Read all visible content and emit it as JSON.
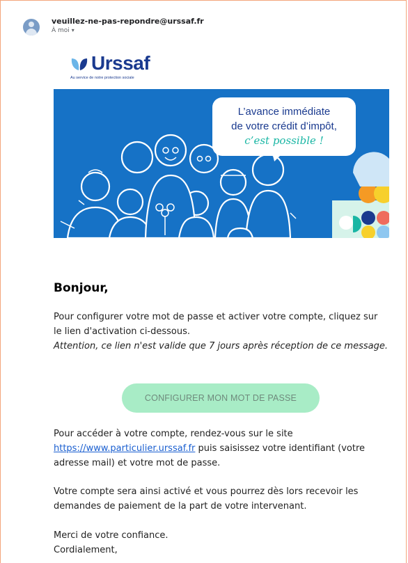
{
  "email": {
    "sender": "veuillez-ne-pas-repondre@urssaf.fr",
    "to": "À moi",
    "to_caret": "▾"
  },
  "logo": {
    "name": "Urssaf",
    "tagline": "Au service de notre protection sociale",
    "colors": {
      "brand": "#1a3a8f",
      "leaf_left": "#6bb5e8",
      "leaf_right": "#1a3a8f"
    }
  },
  "banner": {
    "line1": "L’avance immédiate",
    "line2": "de votre crédit d’impôt,",
    "line3": "c’est possible !",
    "colors": {
      "background": "#1672c6",
      "accent": "#19b6a4"
    }
  },
  "body": {
    "greeting": "Bonjour,",
    "para1": "Pour configurer votre mot de passe et activer votre compte, cliquez sur le lien d'activation ci-dessous.",
    "para2": "Attention, ce lien n'est valide que 7 jours après réception de ce message.",
    "cta_label": "CONFIGURER MON MOT DE PASSE",
    "para3_before": "Pour accéder à votre compte, rendez-vous sur le site ",
    "para3_link": "https://www.particulier.urssaf.fr",
    "para3_after": " puis saisissez votre identifiant (votre adresse mail) et votre mot de passe.",
    "para4": "Votre compte sera ainsi activé et vous pourrez dès lors recevoir les demandes de paiement de la part de votre intervenant.",
    "closing1": "Merci de votre confiance.",
    "closing2": "Cordialement,"
  }
}
